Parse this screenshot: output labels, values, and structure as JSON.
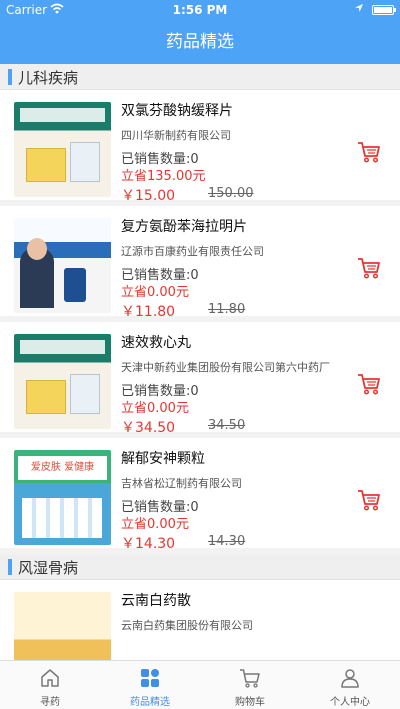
{
  "status_bar": {
    "carrier": "Carrier",
    "time": "1:56 PM"
  },
  "nav": {
    "title": "药品精选"
  },
  "sections": [
    {
      "title": "儿科疾病",
      "products": [
        {
          "name": "双氯芬酸钠缓释片",
          "maker": "四川华新制药有限公司",
          "sold": "已销售数量:0",
          "save": "立省135.00元",
          "price": "￥15.00",
          "original": "150.00"
        },
        {
          "name": "复方氨酚苯海拉明片",
          "maker": "辽源市百康药业有限责任公司",
          "sold": "已销售数量:0",
          "save": "立省0.00元",
          "price": "￥11.80",
          "original": "11.80"
        },
        {
          "name": "速效救心丸",
          "maker": "天津中新药业集团股份有限公司第六中药厂",
          "sold": "已销售数量:0",
          "save": "立省0.00元",
          "price": "￥34.50",
          "original": "34.50"
        },
        {
          "name": "解郁安神颗粒",
          "maker": "吉林省松辽制药有限公司",
          "sold": "已销售数量:0",
          "save": "立省0.00元",
          "price": "￥14.30",
          "original": "14.30"
        }
      ]
    },
    {
      "title": "风湿骨病",
      "products": [
        {
          "name": "云南白药散",
          "maker": "云南白药集团股份有限公司"
        }
      ]
    }
  ],
  "thumb_text": {
    "banner_4": "爱皮肤 爱健康"
  },
  "tabs": [
    {
      "label": "寻药",
      "icon": "home-icon"
    },
    {
      "label": "药品精选",
      "icon": "grid-icon"
    },
    {
      "label": "购物车",
      "icon": "cart-icon"
    },
    {
      "label": "个人中心",
      "icon": "user-icon"
    }
  ],
  "colors": {
    "primary": "#4da3f5",
    "price_red": "#e8362e",
    "tab_active": "#3f8fe6"
  }
}
